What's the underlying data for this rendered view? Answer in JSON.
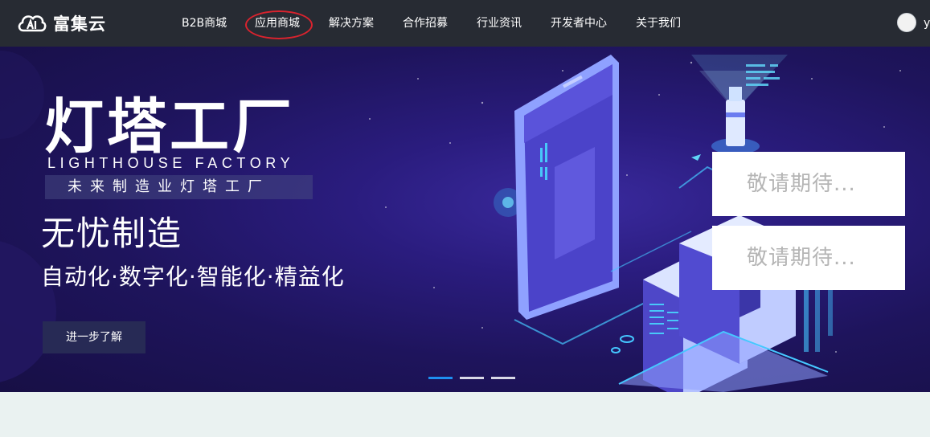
{
  "brand": {
    "name": "富集云",
    "logo_icon": "cloud-logo-icon"
  },
  "nav": {
    "items": [
      {
        "label": "B2B商城"
      },
      {
        "label": "应用商城",
        "highlighted": true
      },
      {
        "label": "解决方案"
      },
      {
        "label": "合作招募"
      },
      {
        "label": "行业资讯"
      },
      {
        "label": "开发者中心"
      },
      {
        "label": "关于我们"
      }
    ],
    "user_initial": "y"
  },
  "banner": {
    "title": "灯塔工厂",
    "title_en": "LIGHTHOUSE FACTORY",
    "tagline": "未来制造业灯塔工厂",
    "subtitle": "无忧制造",
    "features": "自动化·数字化·智能化·精益化",
    "button_label": "进一步了解",
    "cards": [
      "敬请期待...",
      "敬请期待..."
    ],
    "slides_total": 3,
    "active_slide": 1
  },
  "colors": {
    "topbar_bg": "#272b33",
    "banner_bg": "#1e145c",
    "accent_dot": "#1e8ff0",
    "highlight_circle": "#d9232e",
    "page_bg": "#eaf2f1"
  }
}
